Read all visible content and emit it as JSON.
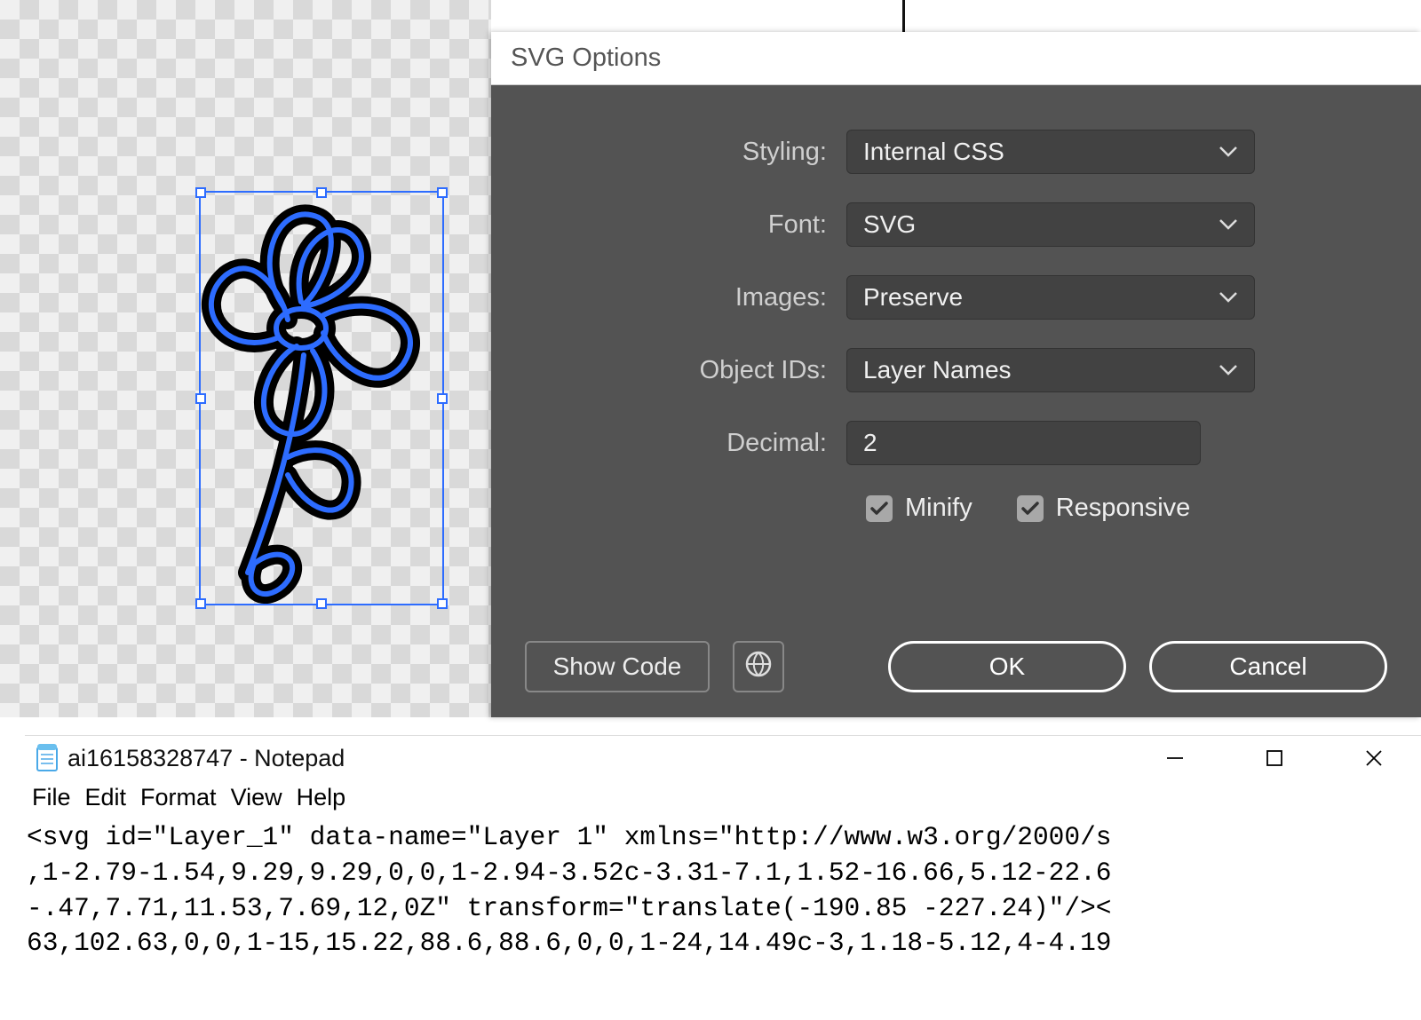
{
  "dialog": {
    "title": "SVG Options",
    "fields": {
      "styling": {
        "label": "Styling:",
        "value": "Internal CSS"
      },
      "font": {
        "label": "Font:",
        "value": "SVG"
      },
      "images": {
        "label": "Images:",
        "value": "Preserve"
      },
      "objectIds": {
        "label": "Object IDs:",
        "value": "Layer Names"
      },
      "decimal": {
        "label": "Decimal:",
        "value": "2"
      }
    },
    "checkboxes": {
      "minify": {
        "label": "Minify",
        "checked": true
      },
      "responsive": {
        "label": "Responsive",
        "checked": true
      }
    },
    "buttons": {
      "showCode": "Show Code",
      "ok": "OK",
      "cancel": "Cancel"
    }
  },
  "notepad": {
    "title": "ai16158328747 - Notepad",
    "menu": [
      "File",
      "Edit",
      "Format",
      "View",
      "Help"
    ],
    "lines": [
      "<svg id=\"Layer_1\" data-name=\"Layer 1\" xmlns=\"http://www.w3.org/2000/s",
      ",1-2.79-1.54,9.29,9.29,0,0,1-2.94-3.52c-3.31-7.1,1.52-16.66,5.12-22.6",
      "-.47,7.71,11.53,7.69,12,0Z\" transform=\"translate(-190.85 -227.24)\"/><",
      "63,102.63,0,0,1-15,15.22,88.6,88.6,0,0,1-24,14.49c-3,1.18-5.12,4-4.19"
    ]
  }
}
